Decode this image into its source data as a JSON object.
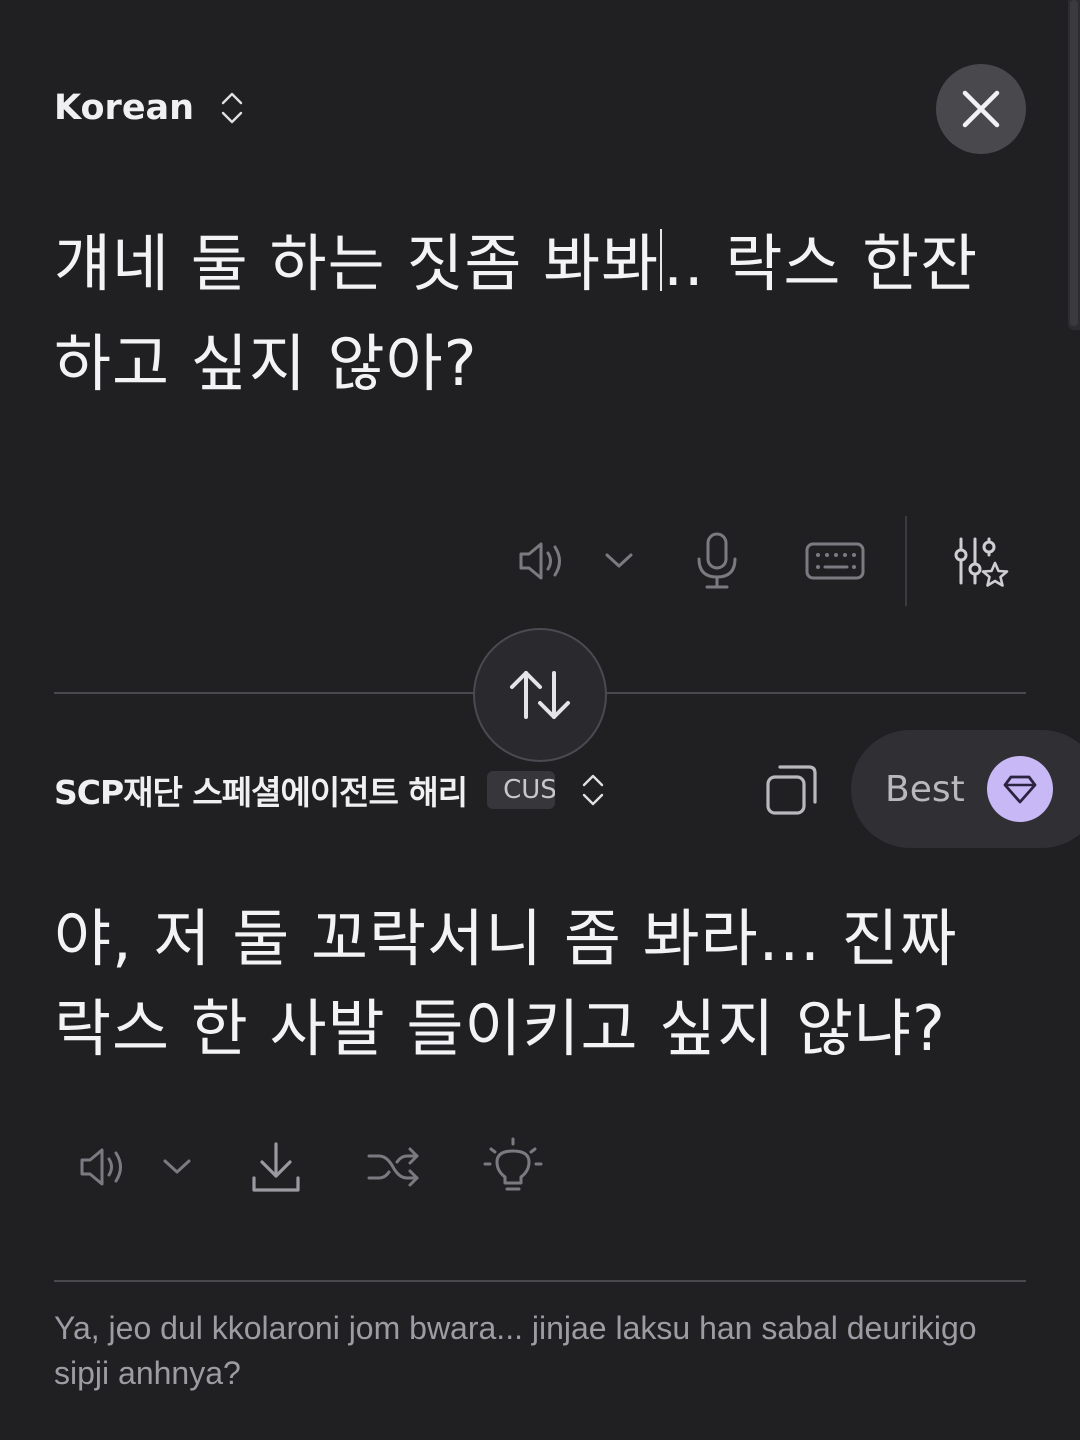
{
  "source": {
    "language": "Korean",
    "text_before_caret": "걔네 둘 하는 짓좀 봐봐",
    "text_after_caret": ".. 락스 한잔 하고 싶지 않아?"
  },
  "target": {
    "language": "SCP재단 스페셜에이전트 해리",
    "badge": "CUS",
    "quality_label": "Best",
    "text": "야, 저 둘 꼬락서니 좀 봐라... 진짜 락스 한 사발 들이키고 싶지 않냐?",
    "romanization": "Ya, jeo dul kkolaroni jom bwara... jinjae laksu han sabal deurikigo sipji anhnya?"
  },
  "icons": {
    "close": "close-icon",
    "speaker": "speaker-icon",
    "chevron": "chevron-down-icon",
    "mic": "microphone-icon",
    "keyboard": "keyboard-icon",
    "settings": "sliders-star-icon",
    "swap": "swap-arrows-icon",
    "copy": "copy-icon",
    "gem": "gem-icon",
    "download": "download-icon",
    "shuffle": "shuffle-icon",
    "bulb": "lightbulb-icon"
  },
  "colors": {
    "background": "#202023",
    "accent": "#c8b8f6",
    "text": "#f3f3f5",
    "muted": "#9c9ca2"
  }
}
